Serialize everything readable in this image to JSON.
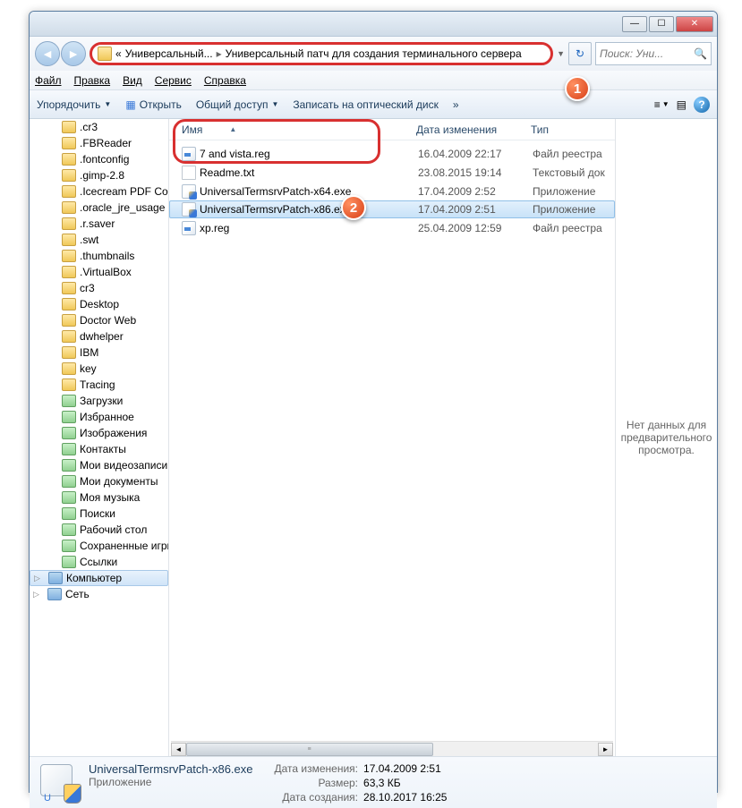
{
  "titlebar": {
    "min": "—",
    "max": "☐",
    "close": "✕"
  },
  "nav": {
    "back": "◄",
    "fwd": "►",
    "crumb1": "«",
    "crumb2": "Универсальный...",
    "crumb3": "Универсальный патч для создания терминального сервера",
    "refresh": "↻"
  },
  "search": {
    "placeholder": "Поиск: Уни..."
  },
  "menu": {
    "file": "Файл",
    "edit": "Правка",
    "view": "Вид",
    "tools": "Сервис",
    "help": "Справка"
  },
  "toolbar": {
    "organize": "Упорядочить",
    "open": "Открыть",
    "share": "Общий доступ",
    "burn": "Записать на оптический диск",
    "more": "»",
    "views": "≡",
    "help": "?"
  },
  "sidebar": {
    "items": [
      {
        "label": ".cr3",
        "icon": "folder"
      },
      {
        "label": ".FBReader",
        "icon": "folder"
      },
      {
        "label": ".fontconfig",
        "icon": "folder"
      },
      {
        "label": ".gimp-2.8",
        "icon": "folder"
      },
      {
        "label": ".Icecream PDF Co",
        "icon": "folder"
      },
      {
        "label": ".oracle_jre_usage",
        "icon": "folder"
      },
      {
        "label": ".r.saver",
        "icon": "folder"
      },
      {
        "label": ".swt",
        "icon": "folder"
      },
      {
        "label": ".thumbnails",
        "icon": "folder"
      },
      {
        "label": ".VirtualBox",
        "icon": "folder"
      },
      {
        "label": "cr3",
        "icon": "folder"
      },
      {
        "label": "Desktop",
        "icon": "folder"
      },
      {
        "label": "Doctor Web",
        "icon": "folder"
      },
      {
        "label": "dwhelper",
        "icon": "folder"
      },
      {
        "label": "IBM",
        "icon": "folder"
      },
      {
        "label": "key",
        "icon": "folder"
      },
      {
        "label": "Tracing",
        "icon": "folder"
      },
      {
        "label": "Загрузки",
        "icon": "special"
      },
      {
        "label": "Избранное",
        "icon": "special"
      },
      {
        "label": "Изображения",
        "icon": "special"
      },
      {
        "label": "Контакты",
        "icon": "special"
      },
      {
        "label": "Мои видеозаписи",
        "icon": "special"
      },
      {
        "label": "Мои документы",
        "icon": "special"
      },
      {
        "label": "Моя музыка",
        "icon": "special"
      },
      {
        "label": "Поиски",
        "icon": "special"
      },
      {
        "label": "Рабочий стол",
        "icon": "special"
      },
      {
        "label": "Сохраненные игры",
        "icon": "special"
      },
      {
        "label": "Ссылки",
        "icon": "special"
      }
    ],
    "computer": "Компьютер",
    "network": "Сеть"
  },
  "columns": {
    "name": "Имя",
    "date": "Дата изменения",
    "type": "Тип"
  },
  "files": [
    {
      "name": "7 and vista.reg",
      "date": "16.04.2009 22:17",
      "type": "Файл реестра",
      "icon": "reg",
      "sel": false
    },
    {
      "name": "Readme.txt",
      "date": "23.08.2015 19:14",
      "type": "Текстовый док",
      "icon": "txt",
      "sel": false
    },
    {
      "name": "UniversalTermsrvPatch-x64.exe",
      "date": "17.04.2009 2:52",
      "type": "Приложение",
      "icon": "exe",
      "sel": false
    },
    {
      "name": "UniversalTermsrvPatch-x86.exe",
      "date": "17.04.2009 2:51",
      "type": "Приложение",
      "icon": "exe",
      "sel": true
    },
    {
      "name": "xp.reg",
      "date": "25.04.2009 12:59",
      "type": "Файл реестра",
      "icon": "reg",
      "sel": false
    }
  ],
  "preview": {
    "text": "Нет данных для предварительного просмотра."
  },
  "details": {
    "filename": "UniversalTermsrvPatch-x86.exe",
    "filetype": "Приложение",
    "date_lbl": "Дата изменения:",
    "date_val": "17.04.2009 2:51",
    "size_lbl": "Размер:",
    "size_val": "63,3 КБ",
    "created_lbl": "Дата создания:",
    "created_val": "28.10.2017 16:25",
    "u": "U"
  },
  "badges": {
    "one": "1",
    "two": "2"
  }
}
